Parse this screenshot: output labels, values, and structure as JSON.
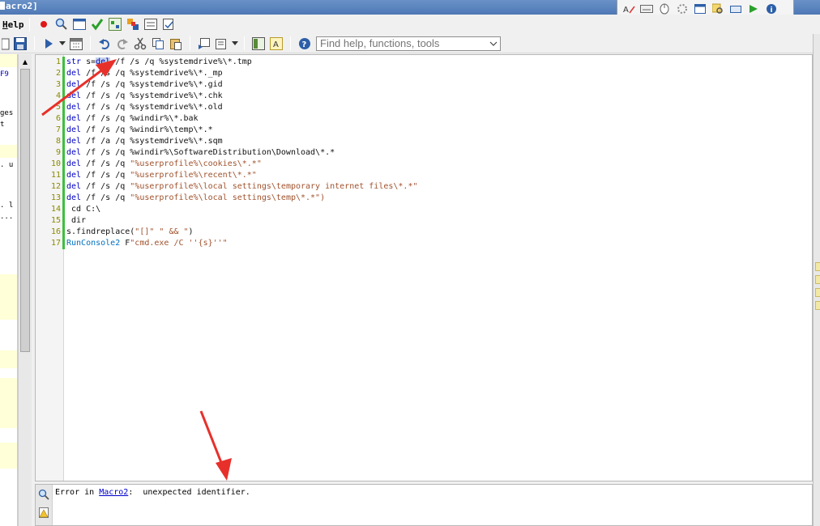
{
  "window": {
    "title": "acro2]"
  },
  "menu": {
    "help_label_first": "H",
    "help_label_rest": "elp"
  },
  "search": {
    "placeholder": "Find help, functions, tools"
  },
  "left_pane": {
    "fragments": [
      "F9",
      "ges",
      "t",
      ". u",
      ". l",
      "... “"
    ]
  },
  "editor": {
    "line_numbers": [
      "1",
      "2",
      "3",
      "4",
      "5",
      "6",
      "7",
      "8",
      "9",
      "10",
      "11",
      "12",
      "13",
      "14",
      "15",
      "16",
      "17"
    ],
    "lines": [
      [
        {
          "t": "str",
          "c": "kw"
        },
        {
          "t": " s=",
          "c": ""
        },
        {
          "t": "del",
          "c": "kw sel"
        },
        {
          "t": " /f /s /q %systemdrive%\\*.tmp",
          "c": ""
        }
      ],
      [
        {
          "t": "del",
          "c": "kw"
        },
        {
          "t": " /f /s /q %systemdrive%\\*._mp",
          "c": ""
        }
      ],
      [
        {
          "t": "del",
          "c": "kw"
        },
        {
          "t": " /f /s /q %systemdrive%\\*.gid",
          "c": ""
        }
      ],
      [
        {
          "t": "del",
          "c": "kw"
        },
        {
          "t": " /f /s /q %systemdrive%\\*.chk",
          "c": ""
        }
      ],
      [
        {
          "t": "del",
          "c": "kw"
        },
        {
          "t": " /f /s /q %systemdrive%\\*.old",
          "c": ""
        }
      ],
      [
        {
          "t": "del",
          "c": "kw"
        },
        {
          "t": " /f /s /q %windir%\\*.bak",
          "c": ""
        }
      ],
      [
        {
          "t": "del",
          "c": "kw"
        },
        {
          "t": " /f /s /q %windir%\\temp\\*.*",
          "c": ""
        }
      ],
      [
        {
          "t": "del",
          "c": "kw"
        },
        {
          "t": " /f /a /q %systemdrive%\\*.sqm",
          "c": ""
        }
      ],
      [
        {
          "t": "del",
          "c": "kw"
        },
        {
          "t": " /f /s /q %windir%\\SoftwareDistribution\\Download\\*.*",
          "c": ""
        }
      ],
      [
        {
          "t": "del",
          "c": "kw"
        },
        {
          "t": " /f /s /q ",
          "c": ""
        },
        {
          "t": "\"%userprofile%\\cookies\\*.*\"",
          "c": "st"
        }
      ],
      [
        {
          "t": "del",
          "c": "kw"
        },
        {
          "t": " /f /s /q ",
          "c": ""
        },
        {
          "t": "\"%userprofile%\\recent\\*.*\"",
          "c": "st"
        }
      ],
      [
        {
          "t": "del",
          "c": "kw"
        },
        {
          "t": " /f /s /q ",
          "c": ""
        },
        {
          "t": "\"%userprofile%\\local settings\\temporary internet files\\*.*\"",
          "c": "st"
        }
      ],
      [
        {
          "t": "del",
          "c": "kw"
        },
        {
          "t": " /f /s /q ",
          "c": ""
        },
        {
          "t": "\"%userprofile%\\local settings\\temp\\*.*\")",
          "c": "st"
        }
      ],
      [
        {
          "t": " cd C:\\",
          "c": ""
        }
      ],
      [
        {
          "t": " dir",
          "c": ""
        }
      ],
      [
        {
          "t": "s.findreplace(",
          "c": ""
        },
        {
          "t": "\"[]\" \" && \"",
          "c": "st"
        },
        {
          "t": ")",
          "c": ""
        }
      ],
      [
        {
          "t": "RunConsole2",
          "c": "fn"
        },
        {
          "t": " F",
          "c": ""
        },
        {
          "t": "\"cmd.exe /C ''{s}''\"",
          "c": "st"
        }
      ]
    ]
  },
  "output": {
    "prefix": "Error in ",
    "link": "Macro2",
    "message": ":  unexpected identifier."
  },
  "colors": {
    "keyword": "#0000c0",
    "string": "#a0522d",
    "function": "#0070c0",
    "arrow": "#e8302a"
  }
}
